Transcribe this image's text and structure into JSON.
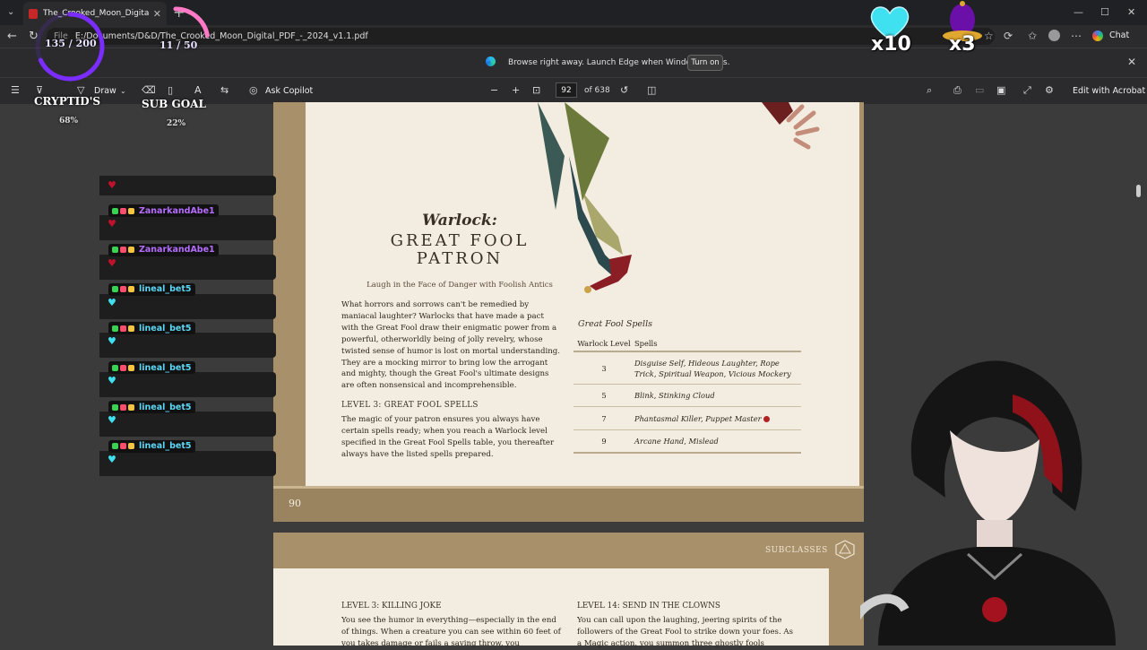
{
  "browser": {
    "tab_title": "The_Crooked_Moon_Digital_PDF_",
    "tab_close": "✕",
    "new_tab": "+",
    "url_prefix": "File",
    "url": "E:/Documents/D&D/The_Crooked_Moon_Digital_PDF_-_2024_v1.1.pdf",
    "chat_label": "Chat",
    "window_controls": [
      "—",
      "☐",
      "✕"
    ]
  },
  "infobar": {
    "message": "Browse right away. Launch Edge when Windows starts.",
    "button": "Turn on",
    "close": "✕"
  },
  "pdf_toolbar": {
    "draw": "Draw",
    "ask_copilot": "Ask Copilot",
    "page_current": "92",
    "page_total": "of 638",
    "edit_acrobat": "Edit with Acrobat"
  },
  "page1": {
    "title_italic": "Warlock:",
    "title_line1": "GREAT FOOL",
    "title_line2": "PATRON",
    "subtitle": "Laugh in the Face of Danger with Foolish Antics",
    "intro": "What horrors and sorrows can't be remedied by maniacal laughter? Warlocks that have made a pact with the Great Fool draw their enigmatic power from a powerful, otherworldly being of jolly revelry, whose twisted sense of humor is lost on mortal understanding. They are a mocking mirror to bring low the arrogant and mighty, though the Great Fool's ultimate designs are often nonsensical and incomprehensible.",
    "level3_heading": "LEVEL 3: GREAT FOOL SPELLS",
    "level3_body": "The magic of your patron ensures you always have certain spells ready; when you reach a Warlock level specified in the Great Fool Spells table, you thereafter always have the listed spells prepared.",
    "table_title": "Great Fool Spells",
    "table_headers": [
      "Warlock Level",
      "Spells"
    ],
    "table_rows": [
      {
        "level": "3",
        "spells": "Disguise Self, Hideous Laughter, Rope Trick, Spiritual Weapon, Vicious Mockery"
      },
      {
        "level": "5",
        "spells": "Blink, Stinking Cloud"
      },
      {
        "level": "7",
        "spells": "Phantasmal Killer, Puppet Master"
      },
      {
        "level": "9",
        "spells": "Arcane Hand, Mislead"
      }
    ],
    "page_number": "90"
  },
  "page2": {
    "section_label": "SUBCLASSES",
    "left_heading": "LEVEL 3: KILLING JOKE",
    "left_body": "You see the humor in everything—especially in the end of things. When a creature you can see within 60 feet of you takes damage or fails a saving throw, you",
    "right_heading": "LEVEL 14: SEND IN THE CLOWNS",
    "right_body": "You can call upon the laughing, jeering spirits of the followers of the Great Fool to strike down your foes. As a Magic action, you summon three ghostly fools"
  },
  "overlay": {
    "goal1": {
      "count": "135 / 200",
      "label": "CRYPTID'S",
      "percent": "68%",
      "progress": 0.68
    },
    "goal2": {
      "count": "11 / 50",
      "label": "SUB GOAL",
      "percent": "22%",
      "progress": 0.22
    },
    "counter_heart": "x10",
    "counter_bell": "x3",
    "chat": [
      {
        "user": "ZanarkandAbe1",
        "color": "#b56cff",
        "emote": "heart-red"
      },
      {
        "user": "ZanarkandAbe1",
        "color": "#b56cff",
        "emote": "heart-red"
      },
      {
        "user": "lineal_bet5",
        "color": "#5bd6f5",
        "emote": "heart-cyan"
      },
      {
        "user": "lineal_bet5",
        "color": "#5bd6f5",
        "emote": "heart-cyan"
      },
      {
        "user": "lineal_bet5",
        "color": "#5bd6f5",
        "emote": "heart-cyan"
      },
      {
        "user": "lineal_bet5",
        "color": "#5bd6f5",
        "emote": "heart-cyan"
      },
      {
        "user": "lineal_bet5",
        "color": "#5bd6f5",
        "emote": "heart-cyan"
      }
    ],
    "colors": {
      "goal_ring": "#7b2cff",
      "heart_cyan": "#3fe0f0",
      "heart_red": "#c0122c"
    }
  }
}
